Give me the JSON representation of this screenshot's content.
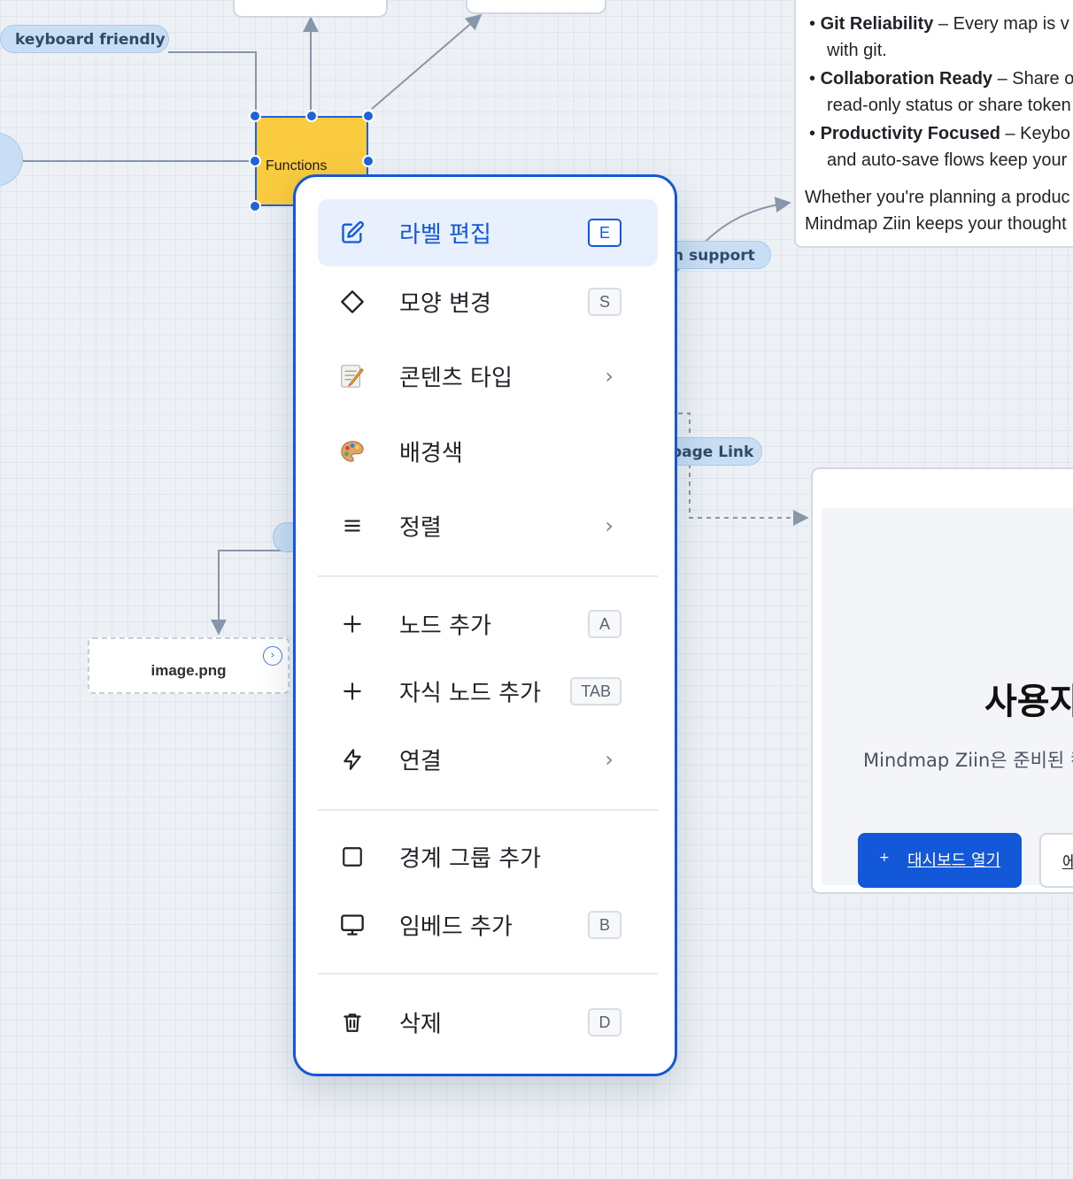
{
  "canvas": {
    "pills": {
      "keyboard_friendly": "keyboard friendly",
      "support": "n support",
      "page_link": "page Link"
    },
    "functions_node": {
      "label": "Functions"
    },
    "image_node": {
      "label": "image.png",
      "chevron": "›"
    },
    "text_card": {
      "items": [
        {
          "bold": "Git Reliability",
          "rest": " – Every map is v",
          "cont": "with git."
        },
        {
          "bold": "Collaboration Ready",
          "rest": " – Share o",
          "cont": "read-only status or share token"
        },
        {
          "bold": "Productivity Focused",
          "rest": " – Keybo",
          "cont": "and auto-save flows keep your"
        }
      ],
      "footer_line1": "Whether you're planning a produc",
      "footer_line2": "Mindmap Ziin keeps your thought"
    },
    "embed_card": {
      "title": "사용자",
      "desc": "Mindmap Ziin은 준비된 컨",
      "primary_button_icon": "+",
      "primary_button": "대시보드 열기",
      "secondary_button": "에"
    }
  },
  "menu": {
    "items": [
      {
        "label": "라벨 편집",
        "shortcut": "E",
        "icon": "edit-icon",
        "active": true
      },
      {
        "label": "모양 변경",
        "shortcut": "S",
        "icon": "diamond-icon"
      },
      {
        "label": "콘텐츠 타입",
        "chevron": "›",
        "icon": "memo-icon"
      },
      {
        "label": "배경색",
        "icon": "palette-icon"
      },
      {
        "label": "정렬",
        "chevron": "›",
        "icon": "align-icon"
      },
      {
        "label": "노드 추가",
        "shortcut": "A",
        "icon": "plus-icon"
      },
      {
        "label": "자식 노드 추가",
        "shortcut": "TAB",
        "icon": "plus-icon"
      },
      {
        "label": "연결",
        "chevron": "›",
        "icon": "lightning-icon"
      },
      {
        "label": "경계 그룹 추가",
        "icon": "square-icon"
      },
      {
        "label": "임베드 추가",
        "shortcut": "B",
        "icon": "monitor-icon"
      },
      {
        "label": "삭제",
        "shortcut": "D",
        "icon": "trash-icon"
      }
    ]
  },
  "colors": {
    "accent": "#1358d8",
    "node_yellow": "#fbcb3f",
    "pill_bg": "#c7def5"
  }
}
